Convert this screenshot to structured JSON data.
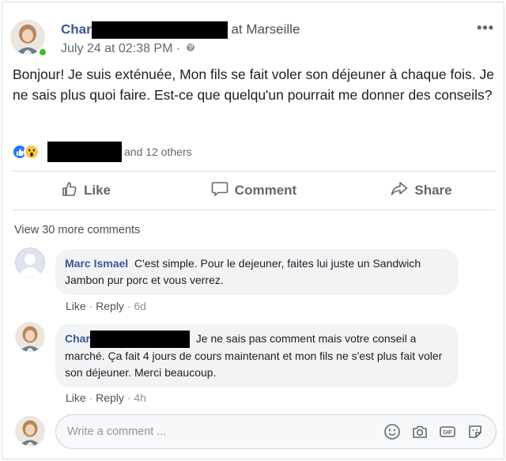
{
  "post": {
    "author_visible": "Char",
    "location_prefix": "at",
    "location": "Marseille",
    "timestamp": "July 24 at 02:38 PM ·",
    "privacy_icon": "globe-icon",
    "menu_icon": "more-options-icon",
    "text": "Bonjour! Je suis exténuée, Mon fils se fait voler son déjeuner à chaque fois. Je ne sais plus quoi faire. Est-ce que quelqu'un pourrait me donner des conseils?",
    "reactions": {
      "icons": [
        "like-reaction-icon",
        "wow-reaction-icon"
      ],
      "others_text": "and 12 others"
    }
  },
  "actions": {
    "like": "Like",
    "comment": "Comment",
    "share": "Share"
  },
  "comments": {
    "view_more": "View 30 more comments",
    "items": [
      {
        "author": "Marc Ismael",
        "text": "C'est simple. Pour le dejeuner, faites lui juste un Sandwich Jambon pur porc et vous verrez.",
        "like": "Like",
        "sep1": " · ",
        "reply": "Reply",
        "sep2": " · ",
        "time": "6d"
      },
      {
        "author": "Char",
        "text": "Je ne sais pas comment mais votre conseil a marché. Ça fait 4 jours de cours maintenant et mon fils ne s'est plus fait voler son déjeuner. Merci beaucoup.",
        "like": "Like",
        "sep1": " · ",
        "reply": "Reply",
        "sep2": " · ",
        "time": "4h"
      }
    ],
    "write_placeholder": "Write a comment ..."
  },
  "colors": {
    "link_blue": "#385898",
    "online_green": "#42b72a",
    "like_blue": "#2078f4",
    "bubble_bg": "#f2f3f5"
  }
}
